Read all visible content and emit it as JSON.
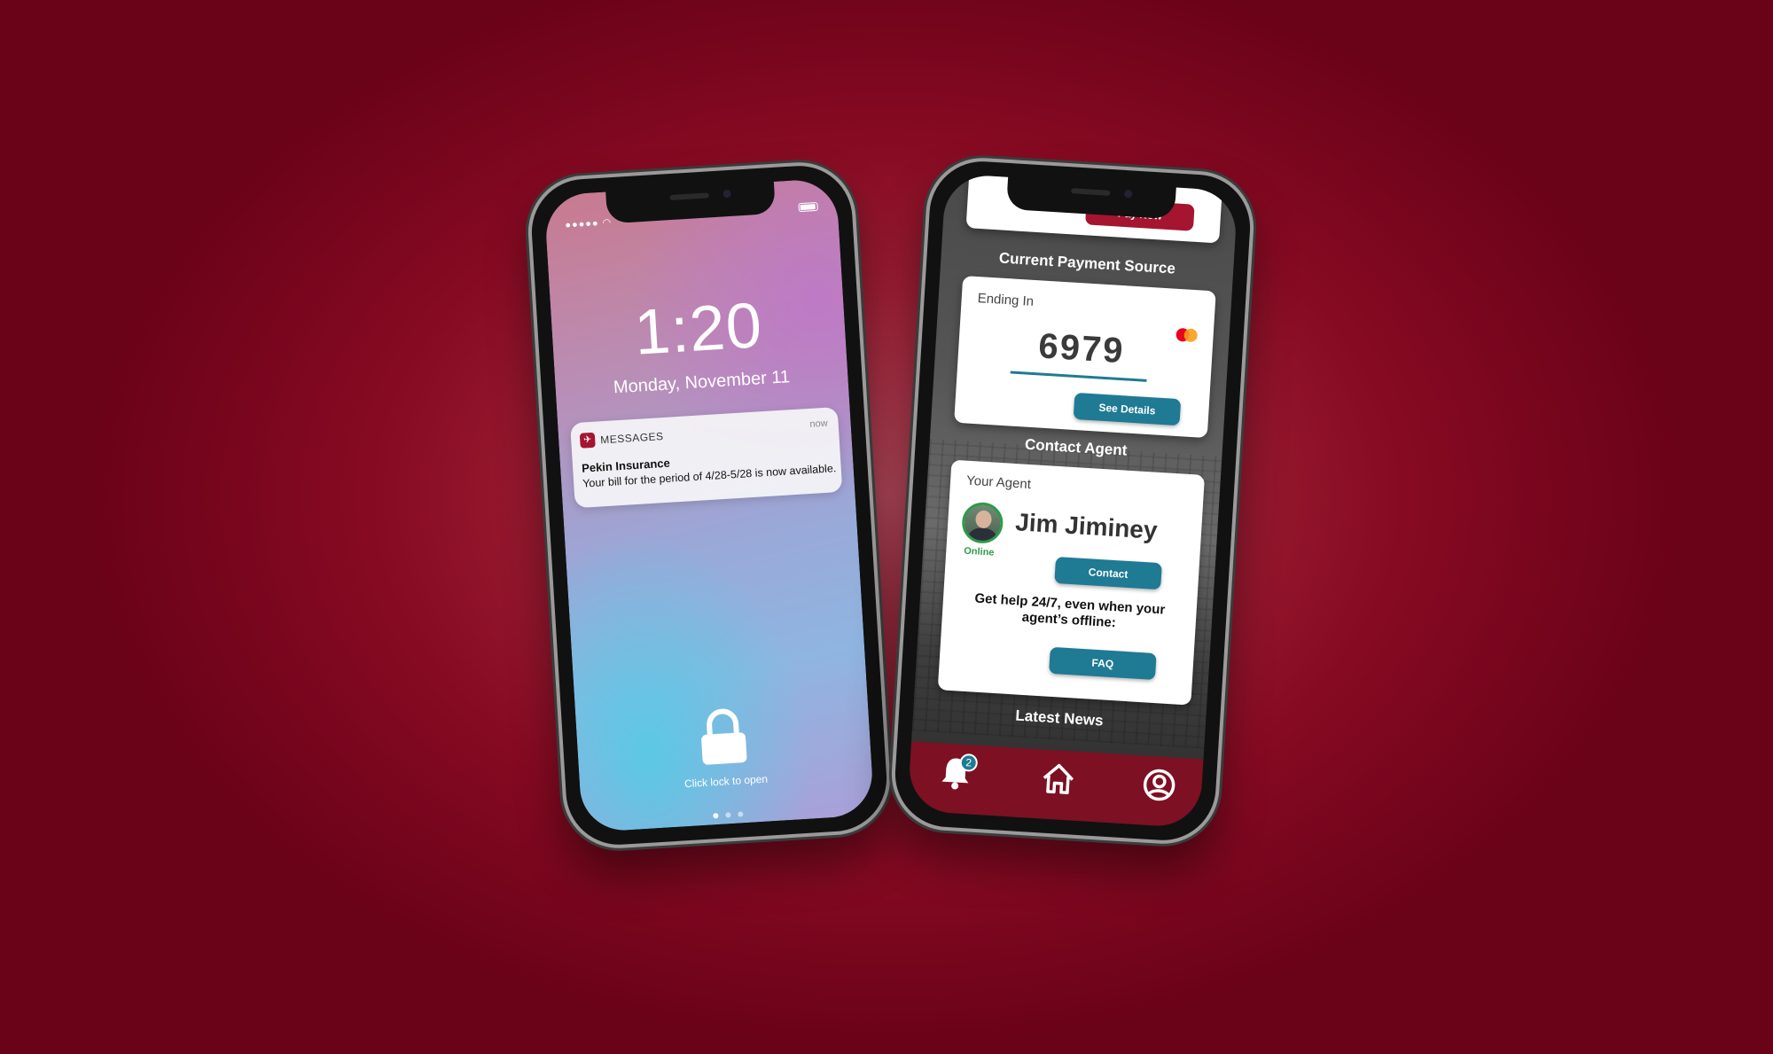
{
  "lock_screen": {
    "time": "1:20",
    "date": "Monday, November 11",
    "notification": {
      "app_name": "MESSAGES",
      "time": "now",
      "sender": "Pekin Insurance",
      "message": "Your bill for the period of 4/28-5/28 is now available."
    },
    "unlock_hint": "Click lock to open",
    "icons": [
      "signal-icon",
      "wifi-icon",
      "battery-icon",
      "lock-icon"
    ]
  },
  "app_screen": {
    "pay_button": "Pay Now",
    "payment_section": {
      "title": "Current Payment Source",
      "label": "Ending In",
      "card_last4": "6979",
      "card_brand_icon": "mastercard-icon",
      "details_button": "See Details"
    },
    "contact_section": {
      "title": "Contact Agent",
      "label": "Your Agent",
      "agent_name": "Jim Jiminey",
      "status": "Online",
      "contact_button": "Contact",
      "help_text": "Get help 24/7, even when your agent’s offline:",
      "faq_button": "FAQ"
    },
    "news_title": "Latest News",
    "tabbar": {
      "notification_count": "2",
      "icons": [
        "bell-icon",
        "home-icon",
        "profile-icon"
      ]
    }
  },
  "colors": {
    "brand_red": "#a51530",
    "teal": "#1f7a94",
    "online_green": "#2e9a4a",
    "tabbar_red": "#7d1022"
  }
}
